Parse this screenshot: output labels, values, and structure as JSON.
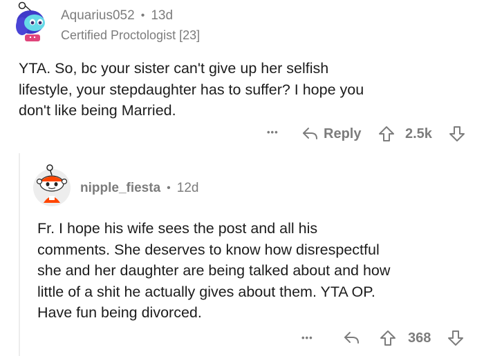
{
  "comment1": {
    "username": "Aquarius052",
    "separator": "•",
    "age": "13d",
    "flair": "Certified Proctologist [23]",
    "body_lines": [
      "YTA. So, bc your sister can't give up her selfish",
      "lifestyle, your stepdaughter has to suffer? I hope you",
      "don't like being Married."
    ],
    "actions": {
      "more": "•••",
      "reply": "Reply",
      "score": "2.5k"
    }
  },
  "comment2": {
    "username": "nipple_fiesta",
    "separator": "•",
    "age": "12d",
    "body_lines": [
      "Fr. I hope his wife sees the post and all his",
      "comments. She deserves to know how disrespectful",
      "she and her daughter are being talked about and how",
      "little of a shit he actually gives about them. YTA OP.",
      "Have fun being divorced."
    ],
    "actions": {
      "more": "•••",
      "score": "368"
    }
  },
  "colors": {
    "meta": "#7c7c7c",
    "text": "#1c1c1c",
    "avatar2_accent": "#ff4500"
  }
}
